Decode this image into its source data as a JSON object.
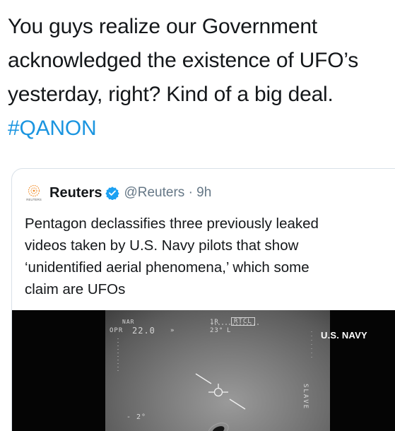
{
  "tweet": {
    "lines": [
      "You guys realize our Government",
      "acknowledged the existence of UFO’s",
      "yesterday, right? Kind of a big deal."
    ],
    "hashtag": "#QANON"
  },
  "quoted_tweet": {
    "avatar_text": "REUTERS",
    "display_name": "Reuters",
    "verified_icon": "verified-badge-icon",
    "handle_time": "@Reuters · 9h",
    "text_lines": [
      "Pentagon declassifies three previously leaked",
      "videos taken by U.S. Navy pilots that show",
      "‘unidentified aerial phenomena,’ which some",
      "claim are UFOs"
    ],
    "media": {
      "overlay_label": "U.S. NAVY",
      "hud": {
        "nar": "NAR",
        "opr": "OPR",
        "value_top_left": "22.0",
        "unit_top_left": "»",
        "top_mid_a": "1R",
        "top_mid_b": "23°",
        "top_mid_c": "L",
        "rtcl": "RTCL",
        "left_number": "- 2°",
        "right_text": "SLAVE"
      }
    }
  },
  "colors": {
    "hashtag": "#1b95e0",
    "verified": "#1da1f2",
    "secondary_text": "#657786",
    "card_border": "#d9e1e8",
    "avatar_orange": "#f28c28"
  }
}
